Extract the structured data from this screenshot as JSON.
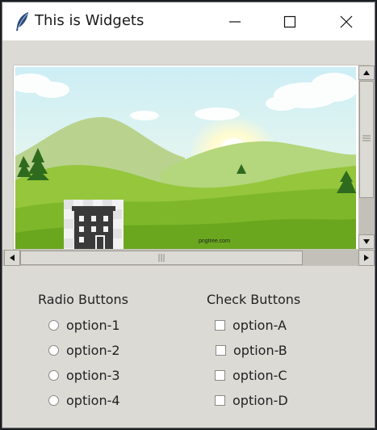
{
  "window": {
    "title": "This is Widgets",
    "icon": "feather-icon",
    "controls": [
      "minimize-icon",
      "maximize-icon",
      "close-icon"
    ]
  },
  "canvas": {
    "watermark": "pngtree.com"
  },
  "radio_group": {
    "title": "Radio Buttons",
    "options": [
      "option-1",
      "option-2",
      "option-3",
      "option-4"
    ]
  },
  "check_group": {
    "title": "Check Buttons",
    "options": [
      "option-A",
      "option-B",
      "option-C",
      "option-D"
    ]
  },
  "colors": {
    "window_bg": "#dcdad5",
    "titlebar_bg": "#ffffff",
    "scrollbar_trough": "#c3c0b9"
  }
}
